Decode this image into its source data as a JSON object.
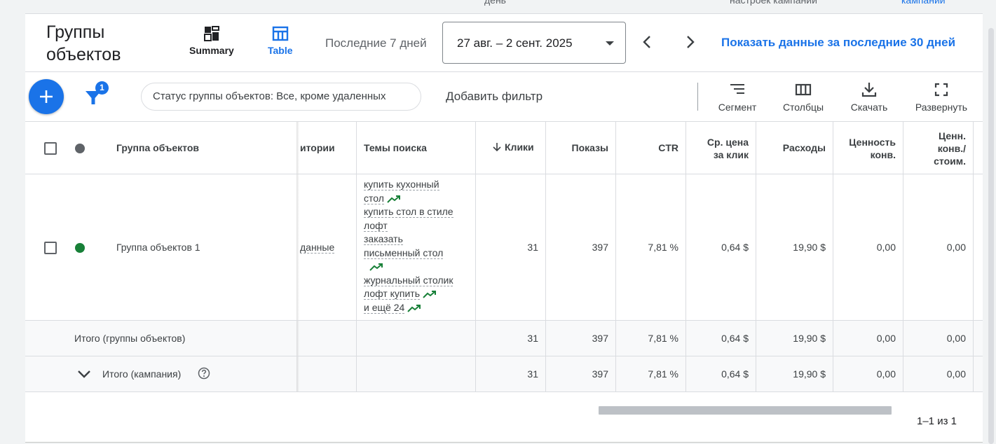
{
  "top_fragments": [
    "день",
    "настроек кампании",
    "кампании"
  ],
  "header": {
    "title_line1": "Группы",
    "title_line2": "объектов",
    "views": {
      "summary": "Summary",
      "table": "Table"
    },
    "range_label": "Последние 7 дней",
    "date_range": "27 авг. – 2 сент. 2025",
    "show_30_link": "Показать данные за последние 30 дней"
  },
  "toolbar": {
    "filter_badge": "1",
    "filter_chip": "Статус группы объектов: Все, кроме удаленных",
    "add_filter": "Добавить фильтр",
    "segment": "Сегмент",
    "columns": "Столбцы",
    "download": "Скачать",
    "expand": "Развернуть"
  },
  "table": {
    "headers": {
      "group": "Группа объектов",
      "audiences": "итории",
      "topics": "Темы поиска",
      "clicks": "Клики",
      "impressions": "Показы",
      "ctr": "CTR",
      "cpc_l1": "Ср. цена",
      "cpc_l2": "за клик",
      "cost": "Расходы",
      "conv_value_l1": "Ценность",
      "conv_value_l2": "конв.",
      "conv_value_cost_l1": "Ценн.",
      "conv_value_cost_l2": "конв./",
      "conv_value_cost_l3": "стоим."
    },
    "row": {
      "name": "Группа объектов 1",
      "audiences": "данные",
      "topics": [
        "купить кухонный",
        "стол",
        "купить стол в стиле",
        "лофт",
        "заказать",
        "письменный стол",
        "журнальный столик",
        "лофт купить",
        "и ещё 24"
      ],
      "clicks": "31",
      "impressions": "397",
      "ctr": "7,81 %",
      "cpc": "0,64 $",
      "cost": "19,90 $",
      "conv_value": "0,00",
      "conv_value_cost": "0,00"
    },
    "total_groups": {
      "label": "Итого (группы объектов)",
      "clicks": "31",
      "impressions": "397",
      "ctr": "7,81 %",
      "cpc": "0,64 $",
      "cost": "19,90 $",
      "conv_value": "0,00",
      "conv_value_cost": "0,00"
    },
    "total_campaign": {
      "label": "Итого (кампания)",
      "clicks": "31",
      "impressions": "397",
      "ctr": "7,81 %",
      "cpc": "0,64 $",
      "cost": "19,90 $",
      "conv_value": "0,00",
      "conv_value_cost": "0,00"
    }
  },
  "pagination": "1–1 из 1",
  "colors": {
    "accent": "#1a73e8",
    "status_enabled": "#188038",
    "trend": "#188038"
  }
}
